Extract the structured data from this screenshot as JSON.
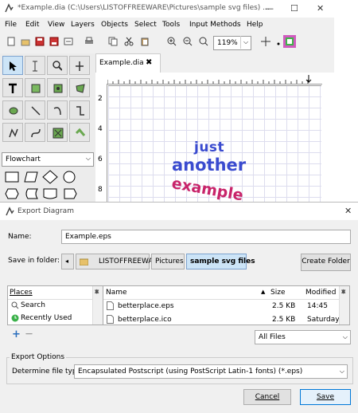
{
  "dia": {
    "title": "*Example.dia (C:\\Users\\LISTOFFREEWARE\\Pictures\\sample svg files) ...",
    "menu": [
      "File",
      "Edit",
      "View",
      "Layers",
      "Objects",
      "Select",
      "Tools",
      "Input Methods",
      "Help"
    ],
    "zoom": "119%",
    "sheet": "Flowchart",
    "tab_label": "Example.dia",
    "ruler_v": [
      "2",
      "4",
      "6",
      "8"
    ],
    "canvas_text": [
      "just",
      "another",
      "example"
    ]
  },
  "dialog": {
    "title": "Export Diagram",
    "name_label": "Name:",
    "name_value": "Example.eps",
    "save_in_label": "Save in folder:",
    "crumbs": [
      "LISTOFFREEWARE",
      "Pictures",
      "sample svg files"
    ],
    "create_folder": "Create Folder",
    "places_header": "Places",
    "places": [
      "Search",
      "Recently Used"
    ],
    "files_header": {
      "name": "Name",
      "size": "Size",
      "modified": "Modified"
    },
    "files": [
      {
        "name": "betterplace.eps",
        "size": "2.5 KB",
        "modified": "14:45"
      },
      {
        "name": "betterplace.ico",
        "size": "2.5 KB",
        "modified": "Saturday"
      }
    ],
    "add": "+",
    "remove": "—",
    "filter": "All Files",
    "export_options": "Export Options",
    "file_type_label": "Determine file type:",
    "file_type_value": "Encapsulated Postscript (using PostScript Latin-1 fonts) (*.eps)",
    "cancel": "Cancel",
    "save": "Save"
  },
  "colors": {
    "accent": "#cce4f7",
    "accent_border": "#7da2ce",
    "canvas_text": "#3a4bcf",
    "canvas_text_red": "#c8246a"
  }
}
